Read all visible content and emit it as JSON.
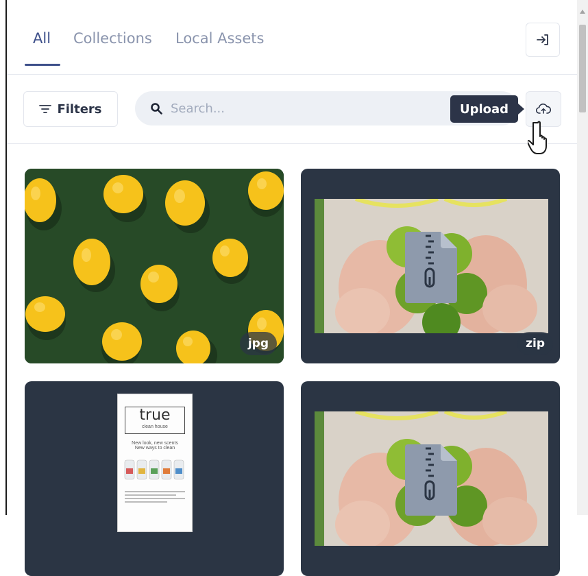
{
  "tabs": [
    {
      "label": "All",
      "active": true
    },
    {
      "label": "Collections",
      "active": false
    },
    {
      "label": "Local Assets",
      "active": false
    }
  ],
  "toolbar": {
    "filters_label": "Filters",
    "search_placeholder": "Search...",
    "search_value": "",
    "upload_tooltip": "Upload"
  },
  "assets": [
    {
      "type_badge": "jpg",
      "thumbnail": "lemons-on-green"
    },
    {
      "type_badge": "zip",
      "thumbnail": "hands-holding-limes"
    },
    {
      "type_badge": "",
      "thumbnail": "true-clean-house-flyer",
      "doc_title": "true",
      "doc_subtitle": "clean house",
      "doc_line1": "New look, new scents",
      "doc_line2": "New ways to clean"
    },
    {
      "type_badge": "",
      "thumbnail": "hands-holding-limes"
    }
  ],
  "icons": {
    "exit": "sign-in-arrow-icon",
    "filters": "filter-lines-icon",
    "search": "magnifier-icon",
    "upload": "cloud-upload-icon",
    "file": "zip-file-icon"
  },
  "colors": {
    "accent": "#3d4f8a",
    "tab_inactive": "#8a94ad",
    "card_bg": "#2b3544",
    "tooltip_bg": "#2c3448",
    "search_bg": "#edf0f5",
    "lemon_bg": "#274a27",
    "lemon": "#f6c21b"
  }
}
